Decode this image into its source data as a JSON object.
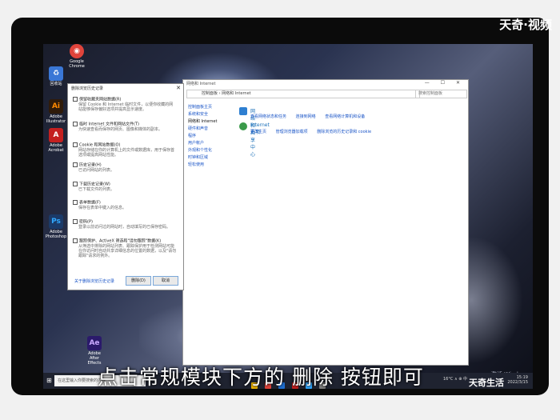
{
  "watermark": "天奇·视频",
  "brand": "天奇生活",
  "subtitle": "点击常规模块下方的 删除 按钮即可",
  "desktop_icons": [
    {
      "label": "回收站",
      "color": "#3a77d6",
      "glyph": "♻"
    },
    {
      "label": "Google Chrome",
      "color": "#e0443b",
      "glyph": "◉"
    },
    {
      "label": "Adobe Acrobat",
      "color": "#c42020",
      "glyph": "A"
    },
    {
      "label": "Adobe Photoshop",
      "color": "#1b3a68",
      "glyph": "Ps"
    },
    {
      "label": "Adobe Illustrator",
      "color": "#ff8a00",
      "glyph": "Ai"
    },
    {
      "label": "Adobe After Effects",
      "color": "#2b1a6b",
      "glyph": "Ae"
    }
  ],
  "dialog": {
    "title": "删除浏览历史记录",
    "options": [
      {
        "label": "保留收藏夹网站数据(R)",
        "desc": "保留 Cookie 和 Internet 临时文件，以便你收藏的网站能够保存偏好选项并提高显示速度。"
      },
      {
        "label": "临时 Internet 文件和网站文件(T)",
        "desc": "为快速查看而保存的网页、图像和媒体的副本。"
      },
      {
        "label": "Cookie 和网站数据(O)",
        "desc": "网站存储在你的计算机上的文件或数据库，用于保存首选项或提高网站性能。"
      },
      {
        "label": "历史记录(H)",
        "desc": "已访问网站的列表。"
      },
      {
        "label": "下载历史记录(W)",
        "desc": "已下载文件的列表。"
      },
      {
        "label": "表单数据(F)",
        "desc": "保存在表单中键入的信息。"
      },
      {
        "label": "密码(P)",
        "desc": "登录以前访问过的网站时，自动填写的已保存密码。"
      },
      {
        "label": "跟踪保护、ActiveX 筛选和\"请勿跟踪\"数据(K)",
        "desc": "从筛选中排除的网站列表、跟踪保护用于检测网站可能在你访问时自动共享详细信息的位置的数据，以及\"请勿跟踪\"请求的例外。"
      }
    ],
    "link": "关于删除浏览历史记录",
    "delete_button": "删除(D)",
    "cancel_button": "取消"
  },
  "control_panel": {
    "title": "网络和 Internet",
    "breadcrumb": "控制面板 › 网络和 Internet",
    "search_placeholder": "搜索控制面板",
    "sidebar": [
      "控制面板主页",
      "系统和安全",
      "网络和 Internet",
      "硬件和声音",
      "程序",
      "用户帐户",
      "外观和个性化",
      "时钟和区域",
      "轻松使用"
    ],
    "sections": [
      {
        "head": "网络和共享中心",
        "links": [
          "查看网络状态和任务",
          "连接到网络",
          "查看网络计算机和设备"
        ]
      },
      {
        "head": "Internet 选项",
        "links": [
          "更改主页",
          "管理浏览器加载项",
          "删除浏览的历史记录和 cookie"
        ]
      }
    ]
  },
  "taskbar": {
    "search_placeholder": "在这里输入你要搜索的内容",
    "tray": "16°C  ∧ ⊕ 中",
    "time": "15:19",
    "date": "2022/3/15"
  },
  "activate_windows": "激活 Windows"
}
